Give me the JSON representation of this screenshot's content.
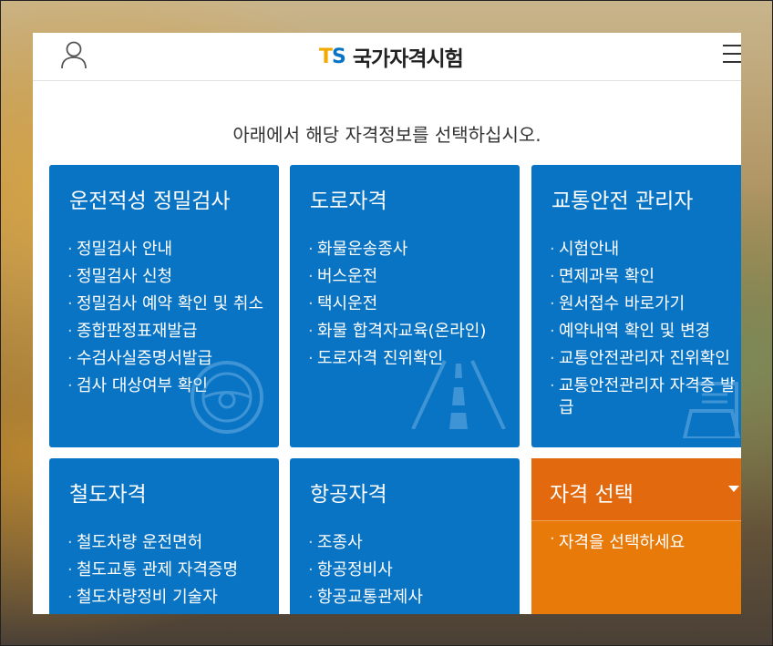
{
  "header": {
    "logo_mark_t": "T",
    "logo_mark_s": "S",
    "logo_text": "국가자격시험",
    "user_icon": "user-icon",
    "menu_icon": "hamburger-menu-icon"
  },
  "guide_text": "아래에서 해당 자격정보를 선택하십시오.",
  "colors": {
    "card_blue": "#0a74c4",
    "card_orange": "#e87a0a",
    "logo_yellow": "#f2a900"
  },
  "cards": {
    "driving": {
      "title": "운전적성 정밀검사",
      "icon": "steering-wheel-icon",
      "items": [
        "정밀검사 안내",
        "정밀검사 신청",
        "정밀검사 예약 확인 및 취소",
        "종합판정표재발급",
        "수검사실증명서발급",
        "검사 대상여부 확인"
      ]
    },
    "road": {
      "title": "도로자격",
      "icon": "road-icon",
      "items": [
        "화물운송종사",
        "버스운전",
        "택시운전",
        "화물 합격자교육(온라인)",
        "도로자격 진위확인"
      ]
    },
    "safety": {
      "title": "교통안전 관리자",
      "icon": "document-icon",
      "items": [
        "시험안내",
        "면제과목 확인",
        "원서접수 바로가기",
        "예약내역 확인 및 변경",
        "교통안전관리자 진위확인",
        "교통안전관리자 자격증 발급"
      ]
    },
    "railway": {
      "title": "철도자격",
      "items": [
        "철도차량 운전면허",
        "철도교통 관제 자격증명",
        "철도차량정비 기술자"
      ]
    },
    "aviation": {
      "title": "항공자격",
      "items": [
        "조종사",
        "항공정비사",
        "항공교통관제사"
      ]
    },
    "select": {
      "title": "자격 선택",
      "option": "자격을 선택하세요"
    }
  }
}
